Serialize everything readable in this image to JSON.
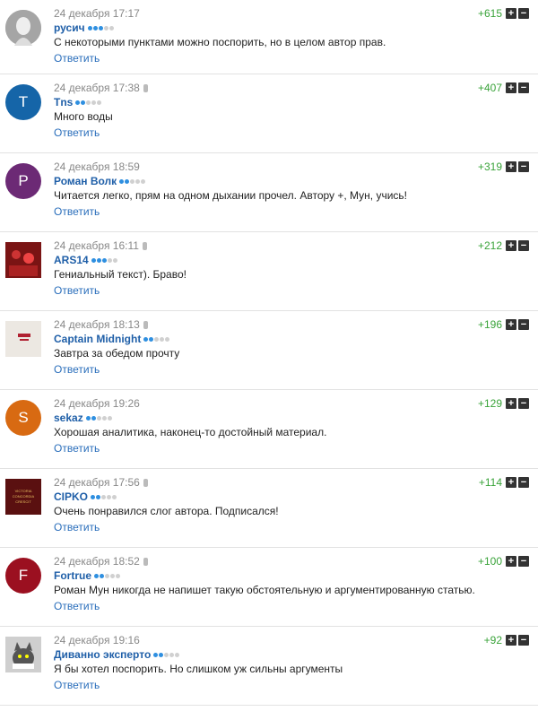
{
  "reply_label": "Ответить",
  "comments": [
    {
      "date": "24 декабря 17:17",
      "author": "русич",
      "text": "С некоторыми пунктами можно поспорить, но в целом автор прав.",
      "score": "+615",
      "rating": 3,
      "mic": false,
      "avatar": {
        "type": "image-anon",
        "color": "#9a9a9a"
      }
    },
    {
      "date": "24 декабря 17:38",
      "author": "Tns",
      "text": "Много воды",
      "score": "+407",
      "rating": 2,
      "mic": true,
      "avatar": {
        "type": "letter",
        "letter": "T",
        "color": "#1565a8"
      }
    },
    {
      "date": "24 декабря 18:59",
      "author": "Роман Волк",
      "text": "Читается легко, прям на одном дыхании прочел. Автору +, Мун, учись!",
      "score": "+319",
      "rating": 2,
      "mic": false,
      "avatar": {
        "type": "letter",
        "letter": "P",
        "color": "#6c2a75"
      }
    },
    {
      "date": "24 декабря 16:11",
      "author": "ARS14",
      "text": "Гениальный текст). Браво!",
      "score": "+212",
      "rating": 3,
      "mic": true,
      "avatar": {
        "type": "image-crowd",
        "color": "#8b1c1c"
      }
    },
    {
      "date": "24 декабря 18:13",
      "author": "Captain Midnight",
      "text": "Завтра за обедом прочту",
      "score": "+196",
      "rating": 2,
      "mic": true,
      "avatar": {
        "type": "image-tshirt",
        "color": "#e6e2dc"
      }
    },
    {
      "date": "24 декабря 19:26",
      "author": "sekaz",
      "text": "Хорошая аналитика, наконец-то достойный материал.",
      "score": "+129",
      "rating": 2,
      "mic": false,
      "avatar": {
        "type": "letter",
        "letter": "S",
        "color": "#d86a12"
      }
    },
    {
      "date": "24 декабря 17:56",
      "author": "CIPKO",
      "text": "Очень понравился слог автора. Подписался!",
      "score": "+114",
      "rating": 2,
      "mic": true,
      "avatar": {
        "type": "image-arsenal",
        "color": "#5a1010",
        "lines": [
          "VICTORIA",
          "CONCORDIA",
          "CRESCIT"
        ]
      }
    },
    {
      "date": "24 декабря 18:52",
      "author": "Fortrue",
      "text": "Роман Мун никогда не напишет такую обстоятельную и аргументированную статью.",
      "score": "+100",
      "rating": 2,
      "mic": true,
      "avatar": {
        "type": "letter",
        "letter": "F",
        "color": "#9b1020"
      }
    },
    {
      "date": "24 декабря 19:16",
      "author": "Диванно экспeрто",
      "text": "Я бы хотел поспорить. Но слишком уж сильны аргументы",
      "score": "+92",
      "rating": 2,
      "mic": false,
      "avatar": {
        "type": "image-cat",
        "color": "#777"
      }
    }
  ]
}
